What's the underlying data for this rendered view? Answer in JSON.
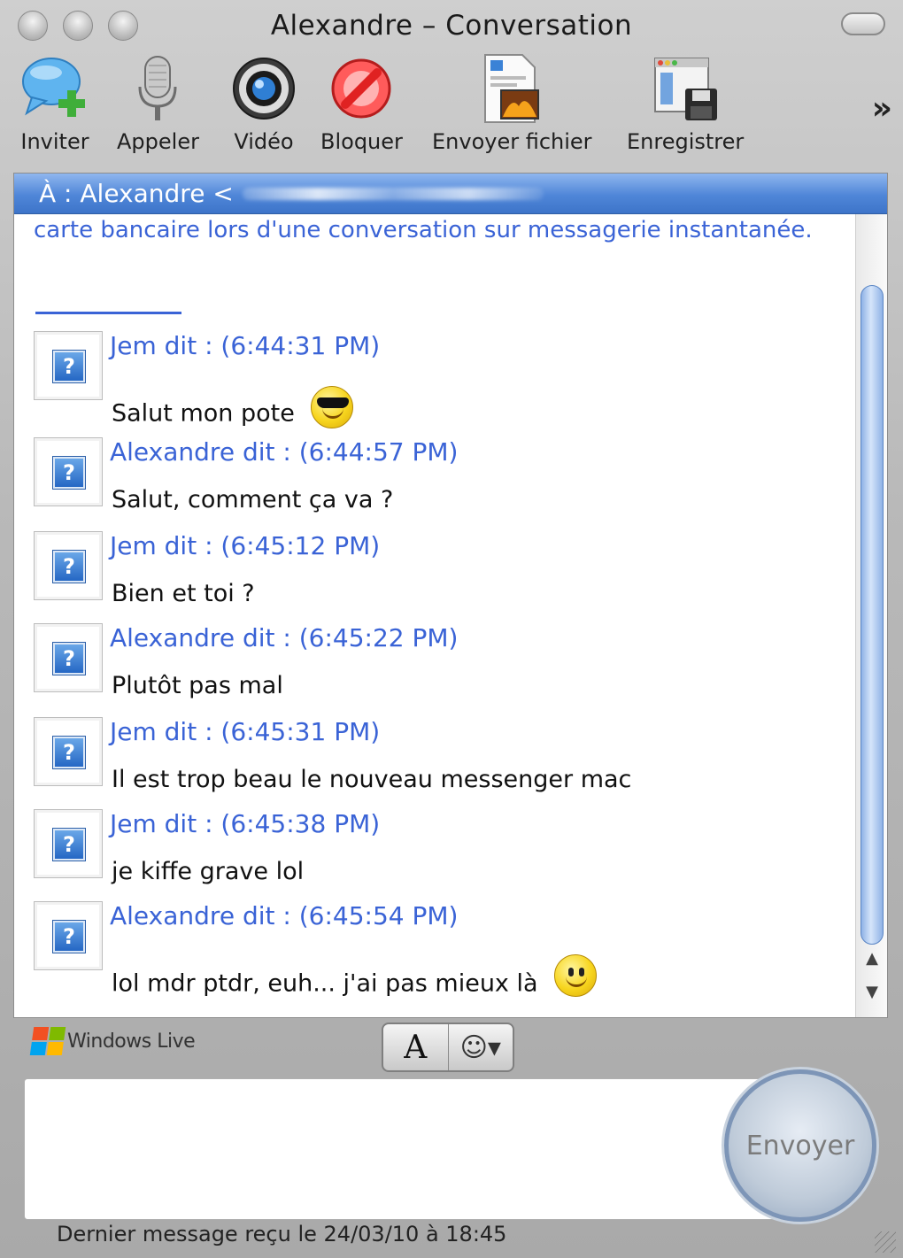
{
  "window": {
    "title": "Alexandre – Conversation"
  },
  "toolbar": {
    "items": [
      {
        "label": "Inviter",
        "icon": "invite-bubble-plus-icon"
      },
      {
        "label": "Appeler",
        "icon": "microphone-icon"
      },
      {
        "label": "Vidéo",
        "icon": "webcam-icon"
      },
      {
        "label": "Bloquer",
        "icon": "block-icon"
      },
      {
        "label": "Envoyer fichier",
        "icon": "send-file-icon"
      },
      {
        "label": "Enregistrer",
        "icon": "save-icon"
      }
    ],
    "overflow": "»"
  },
  "conversation": {
    "to_label": "À : Alexandre <",
    "notice": "carte bancaire lors d'une conversation sur messagerie instantanée.",
    "messages": [
      {
        "header": "Jem dit : (6:44:31 PM)",
        "text": "Salut mon pote",
        "emoticon": "cool-sunglasses"
      },
      {
        "header": "Alexandre dit : (6:44:57 PM)",
        "text": "Salut, comment ça va ?"
      },
      {
        "header": "Jem dit : (6:45:12 PM)",
        "text": "Bien et toi ?"
      },
      {
        "header": "Alexandre dit : (6:45:22 PM)",
        "text": "Plutôt pas mal"
      },
      {
        "header": "Jem dit : (6:45:31 PM)",
        "text": "Il est trop beau le nouveau messenger mac"
      },
      {
        "header": "Jem dit : (6:45:38 PM)",
        "text": "je kiffe grave lol"
      },
      {
        "header": "Alexandre dit : (6:45:54 PM)",
        "text": "lol mdr ptdr, euh... j'ai pas mieux là",
        "emoticon": "smile"
      }
    ]
  },
  "bottom": {
    "brand": "Windows Live",
    "format_font": "A",
    "send_label": "Envoyer",
    "status": "Dernier message reçu le 24/03/10 à 18:45"
  },
  "colors": {
    "accent": "#3a63d6",
    "header_bar": "#4f86d8"
  }
}
